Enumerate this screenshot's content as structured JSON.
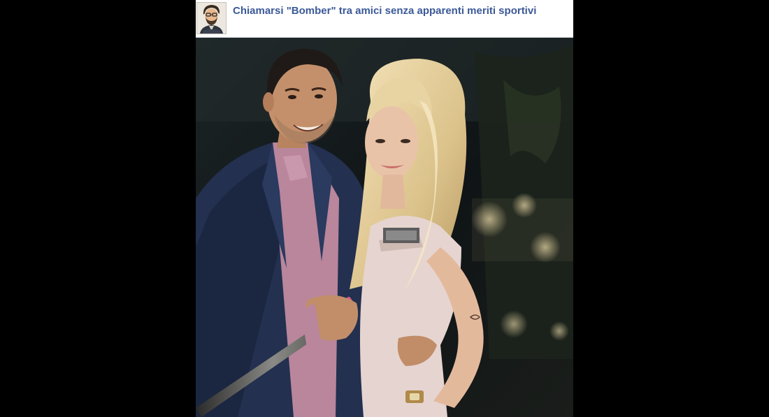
{
  "post": {
    "title": "Chiamarsi \"Bomber\" tra amici senza apparenti meriti sportivi",
    "avatar_icon": "cartoon-man-avatar",
    "photo_subject": "selfie-couple-photo",
    "link_color": "#3b5998",
    "page_bg_color": "#000000"
  }
}
